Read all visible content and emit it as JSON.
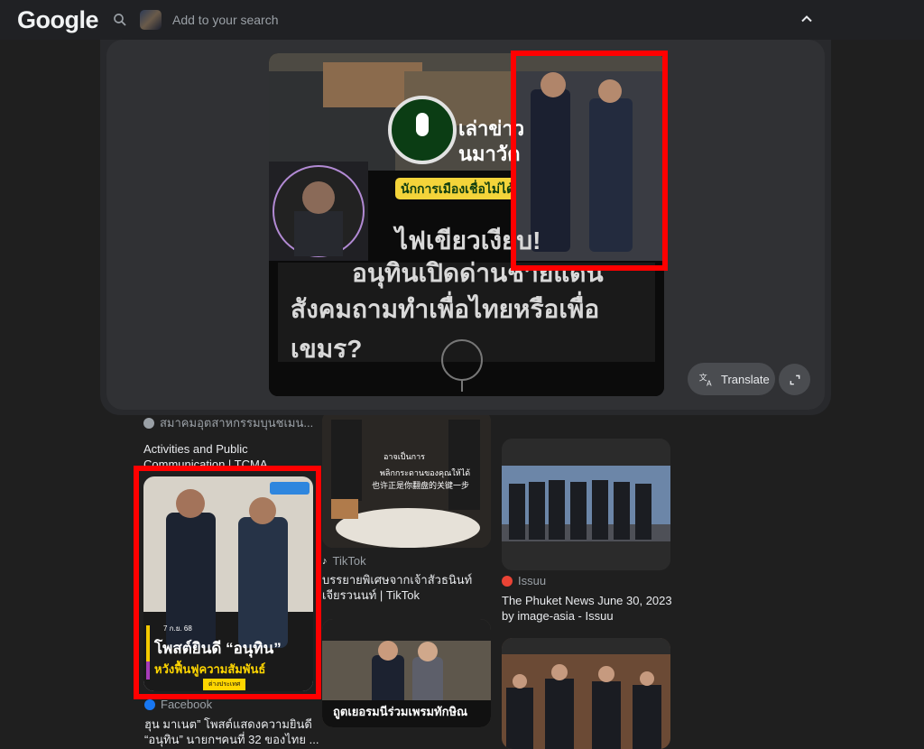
{
  "header": {
    "logo": "Google",
    "search_placeholder": "Add to your search"
  },
  "overlay": {
    "preview_lines": {
      "line1": "เล่าข่าว",
      "line2": "นมาวัด",
      "tag": "นักการเมืองเชื่อไม่ได้",
      "h1": "ไฟเขียวเงียบ!",
      "h2": "อนุทินเปิดด่านชายแดน",
      "h3": "สังคมถามทำเพื่อไทยหรือเพื่อเขมร?"
    },
    "translate_label": "Translate"
  },
  "results": {
    "col1": {
      "top_source": "สมาคมอุตสาหกรรมบุนชเมน...",
      "top_title": "Activities and Public Communication | TCMA",
      "card_date": "7 ก.ย. 68",
      "card_headline": "โพสต์ยินดี “อนุทิน”",
      "card_sub": "หวังฟื้นฟูความสัมพันธ์",
      "card_badge": "ต่างประเทศ",
      "source": "Facebook",
      "title": "ฮุน มาเนต” โพสต์แสดงความยินดี “อนุทิน” นายกฯคนที่ 32 ของไทย ..."
    },
    "col2": {
      "card_text1": "อาจเป็นการ",
      "card_text2": "พลิกกระดานของคุณให้ได้",
      "card_text3": "也许正是你翻盘的关键一步",
      "source": "TikTok",
      "title": "บรรยายพิเศษจากเจ้าสัวธนินท์ เจียรวนนท์ | TikTok",
      "card2_caption": "ถูตเยอรมนีร่วมเพรมทักษิณ"
    },
    "col3": {
      "source": "Issuu",
      "title": "The Phuket News June 30, 2023 by image-asia - Issuu"
    }
  },
  "colors": {
    "highlight": "#ff0000",
    "background": "#1f1f1f",
    "panel": "#303134"
  }
}
